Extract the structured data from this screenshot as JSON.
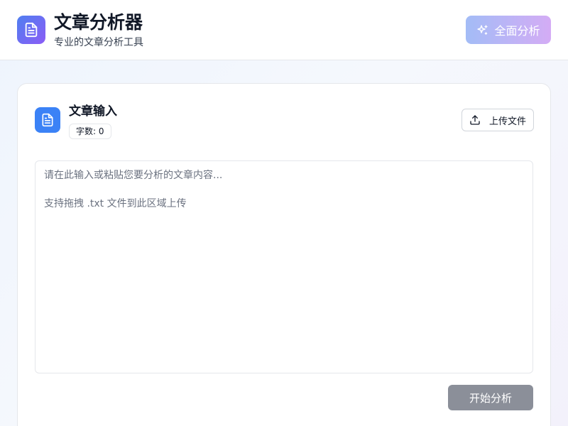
{
  "header": {
    "title": "文章分析器",
    "subtitle": "专业的文章分析工具",
    "analyze_all_label": "全面分析",
    "logo_icon": "document-icon",
    "analyze_all_icon": "sparkles-icon",
    "brand_gradient": [
      "#4f7ff0",
      "#8b5cf6"
    ]
  },
  "input_card": {
    "title": "文章输入",
    "word_count_label": "字数: 0",
    "upload_label": "上传文件",
    "upload_icon": "upload-icon",
    "textarea_placeholder": "请在此输入或粘贴您要分析的文章内容...\n\n支持拖拽 .txt 文件到此区域上传",
    "start_label": "开始分析",
    "accent_color": "#3b82f6"
  }
}
